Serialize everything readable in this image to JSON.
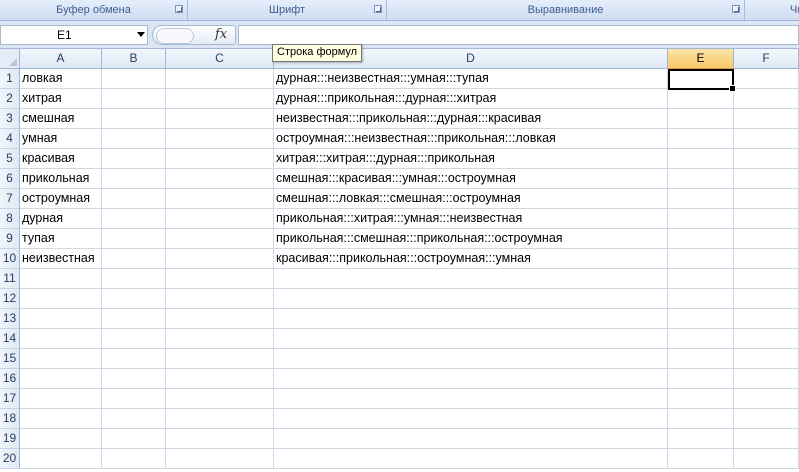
{
  "ribbon": {
    "groups": [
      {
        "label": "Буфер обмена"
      },
      {
        "label": "Шрифт"
      },
      {
        "label": "Выравнивание"
      },
      {
        "label": "Чи"
      }
    ]
  },
  "formula_bar": {
    "name_box_value": "E1",
    "fx_label": "fx",
    "formula_value": "",
    "tooltip": "Строка формул"
  },
  "columns": [
    "A",
    "B",
    "C",
    "D",
    "E",
    "F"
  ],
  "selected_column": "E",
  "rows": [
    {
      "num": "1",
      "A": "ловкая",
      "D": "дурная:::неизвестная:::умная:::тупая"
    },
    {
      "num": "2",
      "A": "хитрая",
      "D": "дурная:::прикольная:::дурная:::хитрая"
    },
    {
      "num": "3",
      "A": "смешная",
      "D": "неизвестная:::прикольная:::дурная:::красивая"
    },
    {
      "num": "4",
      "A": "умная",
      "D": "остроумная:::неизвестная:::прикольная:::ловкая"
    },
    {
      "num": "5",
      "A": "красивая",
      "D": "хитрая:::хитрая:::дурная:::прикольная"
    },
    {
      "num": "6",
      "A": "прикольная",
      "D": "смешная:::красивая:::умная:::остроумная"
    },
    {
      "num": "7",
      "A": "остроумная",
      "D": "смешная:::ловкая:::смешная:::остроумная"
    },
    {
      "num": "8",
      "A": "дурная",
      "D": "прикольная:::хитрая:::умная:::неизвестная"
    },
    {
      "num": "9",
      "A": "тупая",
      "D": "прикольная:::смешная:::прикольная:::остроумная"
    },
    {
      "num": "10",
      "A": "неизвестная",
      "D": "красивая:::прикольная:::остроумная:::умная"
    },
    {
      "num": "11",
      "A": "",
      "D": ""
    },
    {
      "num": "12",
      "A": "",
      "D": ""
    },
    {
      "num": "13",
      "A": "",
      "D": ""
    },
    {
      "num": "14",
      "A": "",
      "D": ""
    },
    {
      "num": "15",
      "A": "",
      "D": ""
    },
    {
      "num": "16",
      "A": "",
      "D": ""
    },
    {
      "num": "17",
      "A": "",
      "D": ""
    },
    {
      "num": "18",
      "A": "",
      "D": ""
    },
    {
      "num": "19",
      "A": "",
      "D": ""
    },
    {
      "num": "20",
      "A": "",
      "D": ""
    }
  ]
}
